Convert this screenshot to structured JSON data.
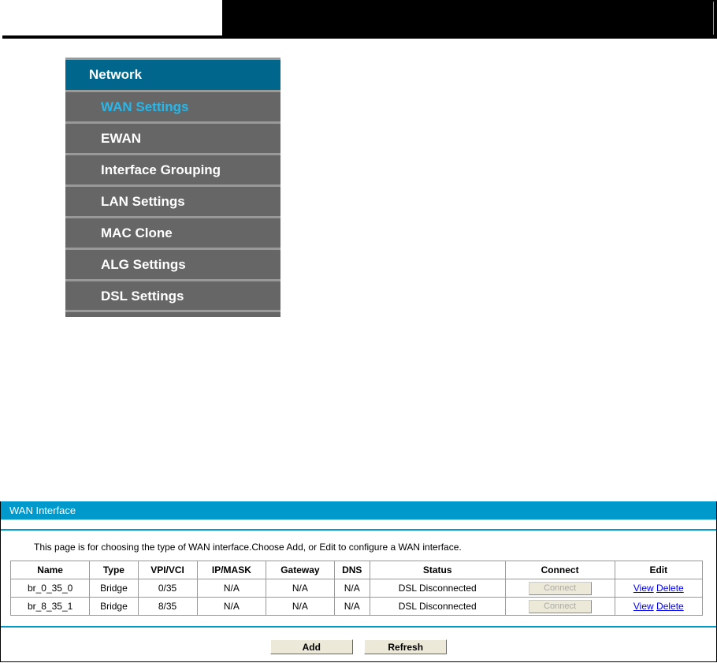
{
  "menu": {
    "header": "Network",
    "items": [
      {
        "label": "WAN Settings",
        "active": true
      },
      {
        "label": "EWAN"
      },
      {
        "label": "Interface Grouping"
      },
      {
        "label": "LAN Settings"
      },
      {
        "label": "MAC Clone"
      },
      {
        "label": "ALG Settings"
      },
      {
        "label": "DSL Settings"
      }
    ]
  },
  "panel": {
    "title": "WAN Interface",
    "description": "This page is for choosing the type of WAN interface.Choose Add, or Edit to configure a WAN interface.",
    "columns": [
      "Name",
      "Type",
      "VPI/VCI",
      "IP/MASK",
      "Gateway",
      "DNS",
      "Status",
      "Connect",
      "Edit"
    ],
    "rows": [
      {
        "name": "br_0_35_0",
        "type": "Bridge",
        "vpivci": "0/35",
        "ipmask": "N/A",
        "gateway": "N/A",
        "dns": "N/A",
        "status": "DSL Disconnected",
        "connect": "Connect",
        "view": "View",
        "delete": "Delete"
      },
      {
        "name": "br_8_35_1",
        "type": "Bridge",
        "vpivci": "8/35",
        "ipmask": "N/A",
        "gateway": "N/A",
        "dns": "N/A",
        "status": "DSL Disconnected",
        "connect": "Connect",
        "view": "View",
        "delete": "Delete"
      }
    ],
    "add": "Add",
    "refresh": "Refresh"
  }
}
